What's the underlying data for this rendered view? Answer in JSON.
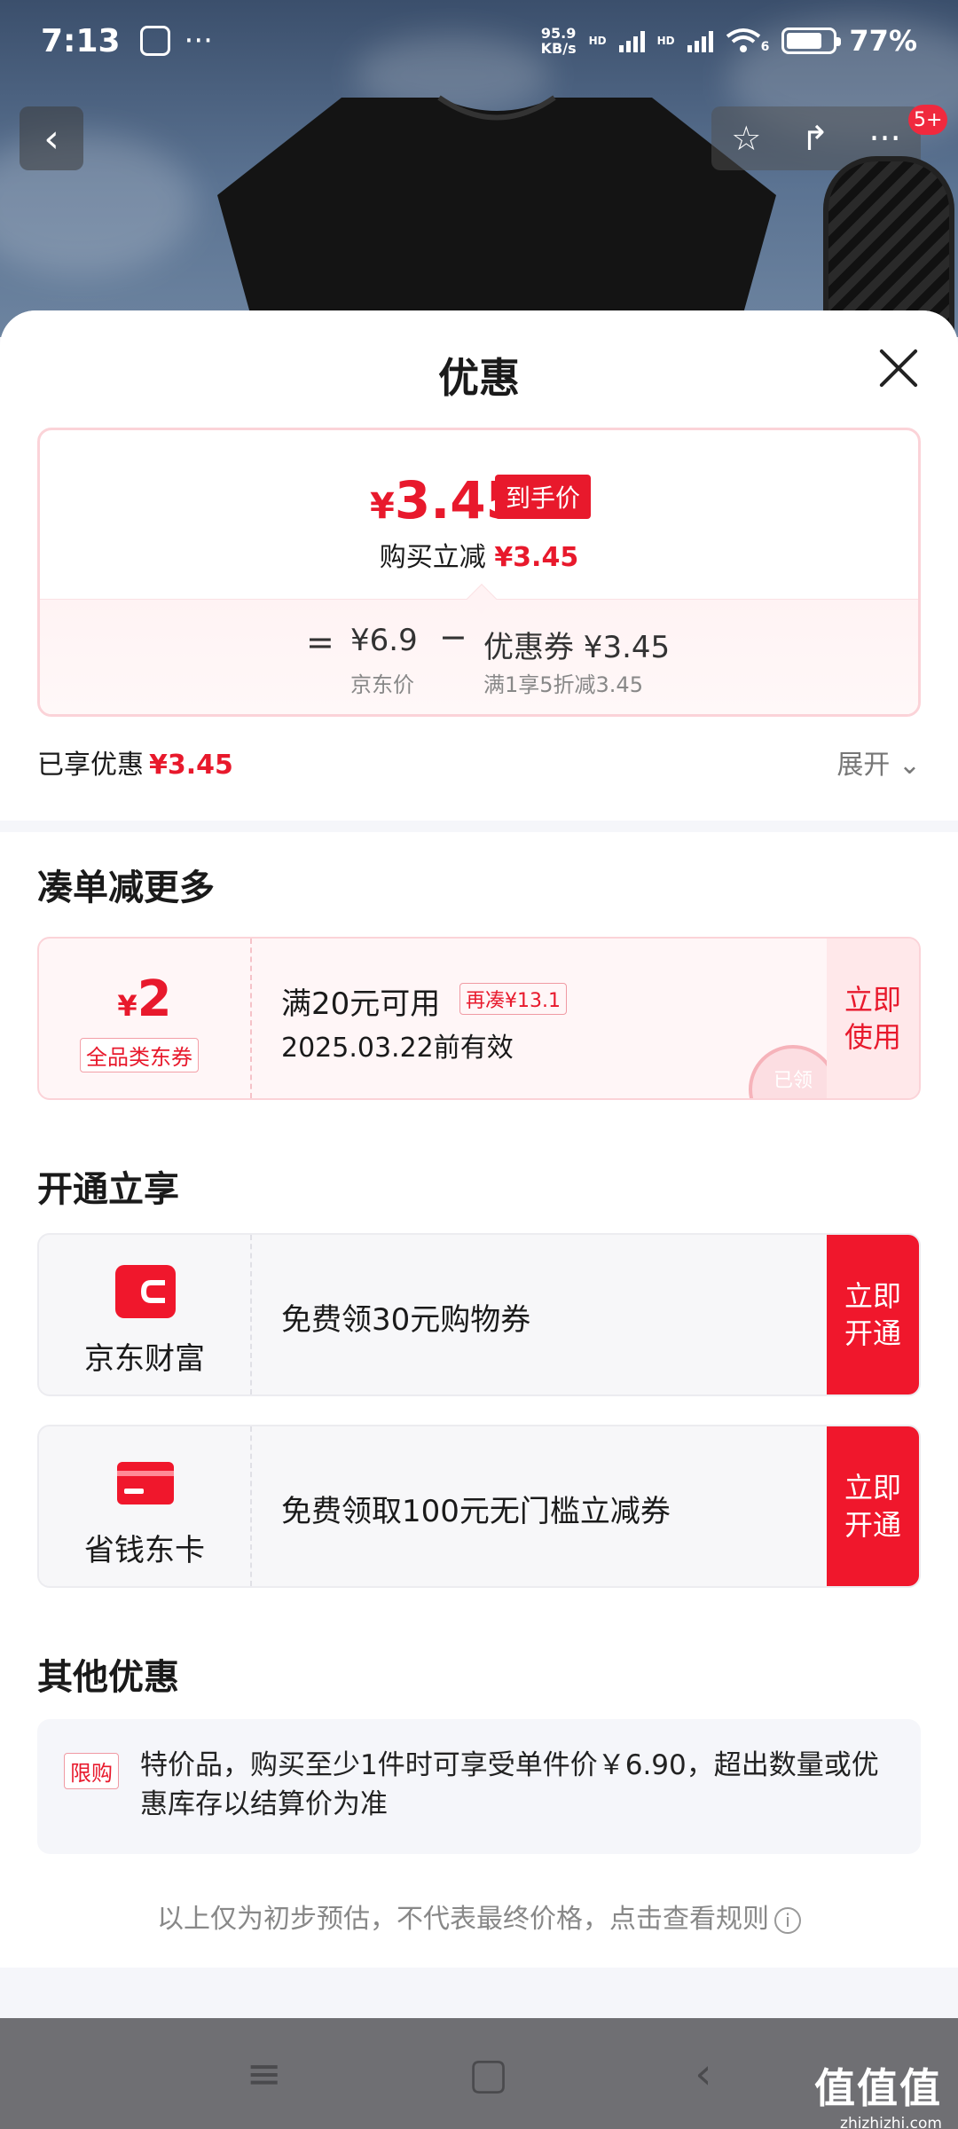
{
  "status_bar": {
    "time": "7:13",
    "dots": "···",
    "speed_top": "95.9",
    "speed_bottom": "KB/s",
    "hd1": "HD",
    "hd2": "HD",
    "wifi_num": "6",
    "battery": "77%",
    "battery_level": 0.77
  },
  "header": {
    "back_glyph": "‹",
    "star_glyph": "☆",
    "share_glyph": "↱",
    "more_glyph": "···",
    "cart_badge": "5+"
  },
  "sheet": {
    "title": "优惠"
  },
  "price_card": {
    "currency": "¥",
    "final_price": "3.45",
    "final_tag": "到手价",
    "save_label": "购买立减",
    "save_value": "¥3.45",
    "eq": "=",
    "jd_price": "¥6.9",
    "jd_label": "京东价",
    "minus": "−",
    "coupon_price": "优惠券 ¥3.45",
    "coupon_label": "满1享5折减3.45"
  },
  "enjoyed": {
    "label": "已享优惠",
    "value": "¥3.45",
    "expand": "展开 ⌄"
  },
  "more_section": {
    "title": "凑单减更多",
    "coupon": {
      "currency": "¥",
      "amount": "2",
      "kind": "全品类东券",
      "cond": "满20元可用",
      "pill": "再凑¥13.1",
      "expire": "2025.03.22前有效",
      "use_label": "立即使用",
      "stamp": "已领"
    }
  },
  "open_section": {
    "title": "开通立享",
    "items": [
      {
        "name": "京东财富",
        "desc": "免费领30元购物券",
        "action": "立即开通"
      },
      {
        "name": "省钱东卡",
        "desc": "免费领取100元无门槛立减券",
        "action": "立即开通"
      }
    ]
  },
  "other_section": {
    "title": "其他优惠",
    "tag": "限购",
    "text": "特价品，购买至少1件时可享受单件价￥6.90，超出数量或优惠库存以结算价为准"
  },
  "footnote": "以上仅为初步预估，不代表最终价格，点击查看规则",
  "navbar": {
    "menu": "≡",
    "home": "▢",
    "back": "‹"
  },
  "watermark": {
    "big": "值值值",
    "small": "zhizhizhi.com"
  },
  "colors": {
    "accent": "#e8192c",
    "open_btn": "#f0172c"
  }
}
